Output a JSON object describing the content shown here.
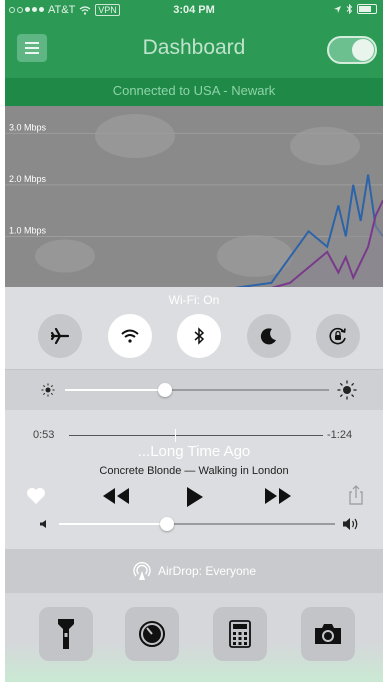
{
  "status_bar": {
    "carrier": "AT&T",
    "vpn_badge": "VPN",
    "time": "3:04 PM"
  },
  "app": {
    "title": "Dashboard",
    "connection_status": "Connected to USA - Newark",
    "vpn_toggle_on": true
  },
  "chart_data": {
    "type": "line",
    "title": "",
    "xlabel": "",
    "ylabel": "",
    "tick_labels": [
      "3.0 Mbps",
      "2.0 Mbps",
      "1.0 Mbps"
    ],
    "yticks": [
      3.0,
      2.0,
      1.0
    ],
    "ylim": [
      0,
      3.2
    ],
    "grid": true,
    "series": [
      {
        "color": "#2d63a8",
        "x": [
          0,
          10,
          20,
          30,
          40,
          50,
          60,
          70,
          75,
          80,
          85,
          88,
          90,
          92,
          94,
          96,
          98,
          100
        ],
        "values": [
          0,
          0,
          0,
          0,
          0,
          0,
          0,
          0.1,
          0.6,
          1.1,
          0.8,
          1.6,
          1.0,
          2.0,
          1.3,
          2.2,
          1.2,
          1.0
        ]
      },
      {
        "color": "#7a3a8c",
        "x": [
          0,
          10,
          20,
          30,
          40,
          50,
          60,
          70,
          75,
          80,
          85,
          88,
          90,
          92,
          94,
          96,
          98,
          100
        ],
        "values": [
          0,
          0,
          0,
          0,
          0,
          0,
          0,
          0,
          0.1,
          0.4,
          0.7,
          0.3,
          0.6,
          0.2,
          0.5,
          0.8,
          1.4,
          1.7
        ]
      }
    ]
  },
  "control_center": {
    "wifi_status": "Wi-Fi: On",
    "toggles": [
      {
        "name": "airplane-icon",
        "on": false
      },
      {
        "name": "wifi-icon",
        "on": true
      },
      {
        "name": "bluetooth-icon",
        "on": true
      },
      {
        "name": "moon-icon",
        "on": false
      },
      {
        "name": "rotation-lock-icon",
        "on": false
      }
    ],
    "brightness_level": 0.38,
    "music": {
      "elapsed": "0:53",
      "remaining": "-1:24",
      "progress": 0.42,
      "song": "...Long Time Ago",
      "artist_album": "Concrete Blonde — Walking in London"
    },
    "volume_level": 0.39,
    "airdrop": "AirDrop: Everyone",
    "apps": [
      "flashlight-icon",
      "timer-icon",
      "calculator-icon",
      "camera-icon"
    ]
  }
}
